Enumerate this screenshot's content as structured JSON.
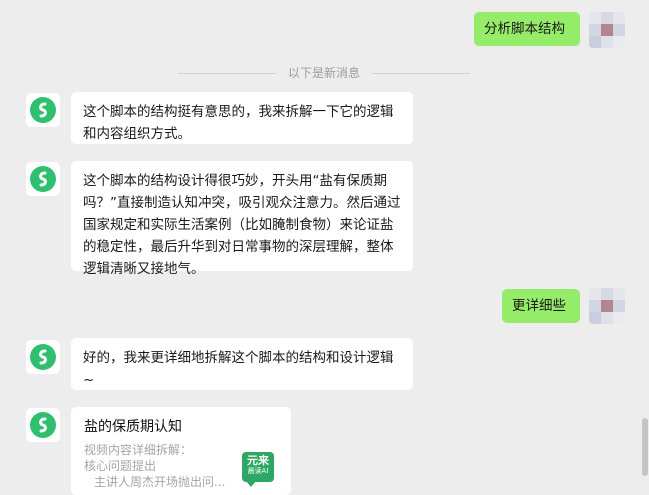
{
  "messages": [
    {
      "from": "user",
      "text": "分析脚本结构"
    },
    {
      "from": "bot",
      "text": "这个脚本的结构挺有意思的，我来拆解一下它的逻辑和内容组织方式。"
    },
    {
      "from": "bot",
      "text": "这个脚本的结构设计得很巧妙，开头用“盐有保质期吗？”直接制造认知冲突，吸引观众注意力。然后通过国家规定和实际生活案例（比如腌制食物）来论证盐的稳定性，最后升华到对日常事物的深层理解，整体逻辑清晰又接地气。"
    },
    {
      "from": "user",
      "text": "更详细些"
    },
    {
      "from": "bot",
      "text": "好的，我来更详细地拆解这个脚本的结构和设计逻辑~"
    }
  ],
  "divider_text": "以下是新消息",
  "card": {
    "title": "盐的保质期认知",
    "line1": "视频内容详细拆解：",
    "line2": "核心问题提出",
    "line3": "主讲人周杰开场抛出问...",
    "badge_line1": "元来",
    "badge_line2": "晨读AI"
  },
  "colors": {
    "background": "#ededed",
    "user_bubble": "#95ec69",
    "bot_bubble": "#ffffff",
    "logo_green": "#2fbf6f"
  }
}
